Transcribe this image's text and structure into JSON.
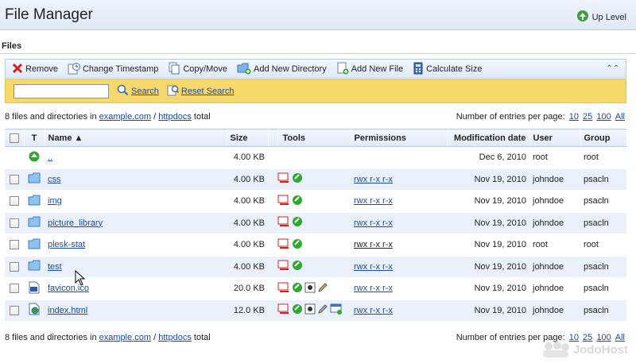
{
  "header": {
    "title": "File Manager",
    "up_level": "Up Level"
  },
  "section": {
    "files_label": "Files"
  },
  "toolbar": {
    "remove": "Remove",
    "change_timestamp": "Change Timestamp",
    "copy_move": "Copy/Move",
    "add_directory": "Add New Directory",
    "add_file": "Add New File",
    "calculate_size": "Calculate Size"
  },
  "search": {
    "value": "",
    "search_label": "Search",
    "reset_label": "Reset Search"
  },
  "summary": {
    "prefix": "8 files and directories in",
    "domain": "example.com",
    "separator": "/",
    "folder": "httpdocs",
    "suffix": "total"
  },
  "pager": {
    "label": "Number of entries per page:",
    "options": [
      "10",
      "25",
      "100",
      "All"
    ]
  },
  "table": {
    "headers": {
      "type": "T",
      "name": "Name",
      "size": "Size",
      "tools": "Tools",
      "permissions": "Permissions",
      "modified": "Modification date",
      "user": "User",
      "group": "Group"
    },
    "rows": [
      {
        "name": "..",
        "size": "4.00 KB",
        "perm": "",
        "modified": "Dec 6, 2010",
        "user": "root",
        "group": "root"
      },
      {
        "name": "css",
        "size": "4.00 KB",
        "perm": "rwx r-x r-x",
        "modified": "Nov 19, 2010",
        "user": "johndoe",
        "group": "psacln"
      },
      {
        "name": "img",
        "size": "4.00 KB",
        "perm": "rwx r-x r-x",
        "modified": "Nov 19, 2010",
        "user": "johndoe",
        "group": "psacln"
      },
      {
        "name": "picture_library",
        "size": "4.00 KB",
        "perm": "rwx r-x r-x",
        "modified": "Nov 19, 2010",
        "user": "johndoe",
        "group": "psacln"
      },
      {
        "name": "plesk-stat",
        "size": "4.00 KB",
        "perm": "rwx r-x r-x",
        "modified": "Nov 19, 2010",
        "user": "root",
        "group": "root"
      },
      {
        "name": "test",
        "size": "4.00 KB",
        "perm": "rwx r-x r-x",
        "modified": "Nov 19, 2010",
        "user": "johndoe",
        "group": "psacln"
      },
      {
        "name": "favicon.ico",
        "size": "20.0 KB",
        "perm": "rwx r-x r-x",
        "modified": "Nov 19, 2010",
        "user": "johndoe",
        "group": "psacln"
      },
      {
        "name": "index.html",
        "size": "12.0 KB",
        "perm": "rwx r-x r-x",
        "modified": "Nov 19, 2010",
        "user": "johndoe",
        "group": "psacln"
      }
    ]
  },
  "watermark": "JodoHost",
  "colors": {
    "accent_yellow": "#f7d96b",
    "header_blue": "#dfe9f7",
    "link": "#1a4aa8"
  }
}
